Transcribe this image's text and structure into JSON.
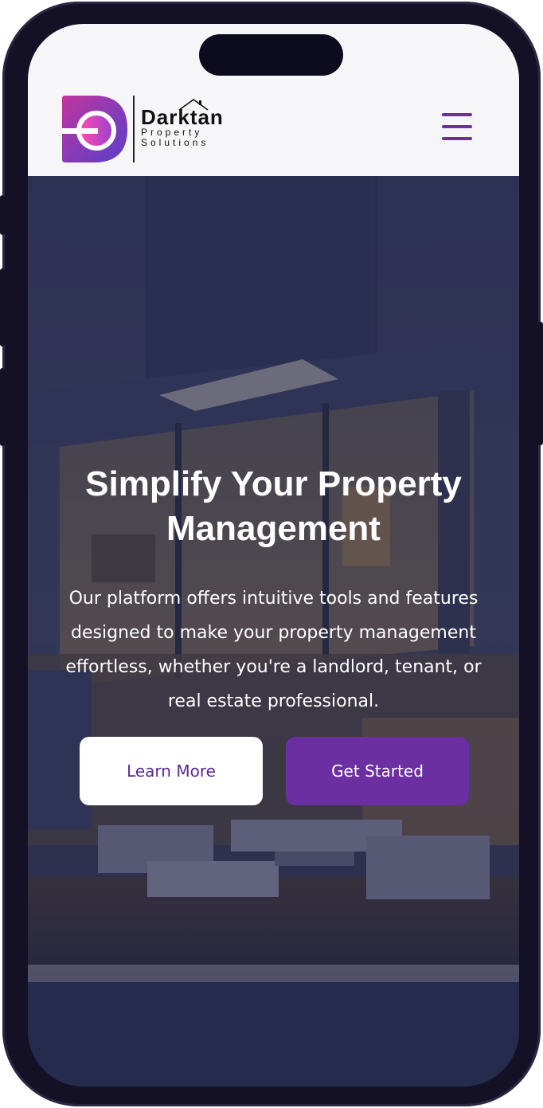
{
  "header": {
    "brand_name": "Darktan",
    "brand_line1": "Property",
    "brand_line2": "Solutions",
    "menu_icon": "hamburger-menu-icon"
  },
  "hero": {
    "title_line1": "Simplify Your Property",
    "title_line2": "Management",
    "description_line1": "Our platform offers intuitive tools and features",
    "description_line2": "designed to make your property management",
    "description_line3": "effortless, whether you're a landlord, tenant, or",
    "description_line4": "real estate professional.",
    "learn_more_label": "Learn More",
    "get_started_label": "Get Started"
  },
  "colors": {
    "accent": "#6b2fa2",
    "header_bg": "#f6f6f9",
    "phone_frame": "#141127"
  }
}
